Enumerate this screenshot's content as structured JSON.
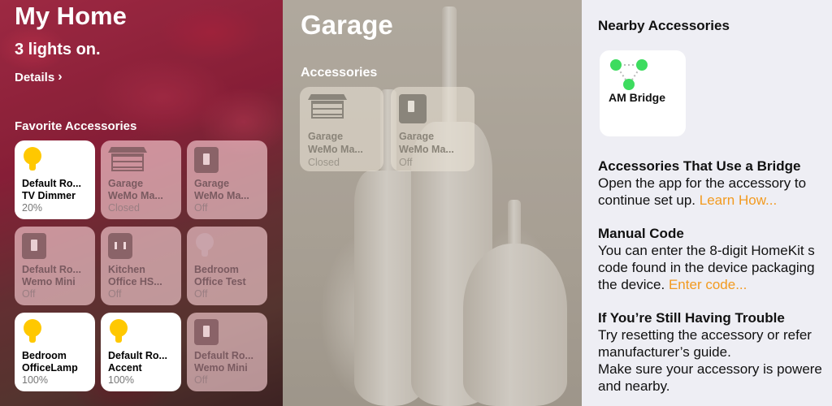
{
  "home": {
    "title": "My Home",
    "status": "3 lights on.",
    "details_label": "Details",
    "details_chevron": "›",
    "section_label": "Favorite Accessories",
    "tiles": [
      {
        "name": "Default Ro...",
        "name2": "TV Dimmer",
        "state": "20%",
        "icon": "bulb-icon",
        "on": true
      },
      {
        "name": "Garage",
        "name2": "WeMo Ma...",
        "state": "Closed",
        "icon": "garage-door-icon",
        "on": false
      },
      {
        "name": "Garage",
        "name2": "WeMo Ma...",
        "state": "Off",
        "icon": "switch-icon",
        "on": false
      },
      {
        "name": "Default Ro...",
        "name2": "Wemo Mini",
        "state": "Off",
        "icon": "switch-icon",
        "on": false
      },
      {
        "name": "Kitchen",
        "name2": "Office HS...",
        "state": "Off",
        "icon": "outlet-icon",
        "on": false
      },
      {
        "name": "Bedroom",
        "name2": "Office Test",
        "state": "Off",
        "icon": "bulb-icon",
        "on": false
      },
      {
        "name": "Bedroom",
        "name2": "OfficeLamp",
        "state": "100%",
        "icon": "bulb-icon",
        "on": true
      },
      {
        "name": "Default Ro...",
        "name2": "Accent",
        "state": "100%",
        "icon": "bulb-icon",
        "on": true
      },
      {
        "name": "Default Ro...",
        "name2": "Wemo Mini",
        "state": "Off",
        "icon": "switch-icon",
        "on": false
      }
    ]
  },
  "garage": {
    "title": "Garage",
    "section_label": "Accessories",
    "tiles": [
      {
        "name": "Garage",
        "name2": "WeMo Ma...",
        "state": "Closed",
        "icon": "garage-door-icon"
      },
      {
        "name": "Garage",
        "name2": "WeMo Ma...",
        "state": "Off",
        "icon": "switch-icon"
      }
    ]
  },
  "nearby": {
    "title": "Nearby Accessories",
    "bridge_label": "AM Bridge",
    "bridge_icon": "bridge-icon",
    "bridge_color": "#3ddc5f",
    "uses_bridge": {
      "heading": "Accessories That Use a Bridge",
      "line1": "Open the app for the accessory to",
      "line2": "continue set up.",
      "link": "Learn How..."
    },
    "manual": {
      "heading": "Manual Code",
      "line1": "You can enter the 8-digit HomeKit s",
      "line2": "code found in the device packaging",
      "line3": "the device.",
      "link": "Enter code..."
    },
    "trouble": {
      "heading": "If You’re Still Having Trouble",
      "line1": "Try resetting the accessory or refer",
      "line2": "manufacturer’s guide.",
      "line3": "Make sure your accessory is powere",
      "line4": "and nearby."
    },
    "link_color": "#f29a1f"
  }
}
